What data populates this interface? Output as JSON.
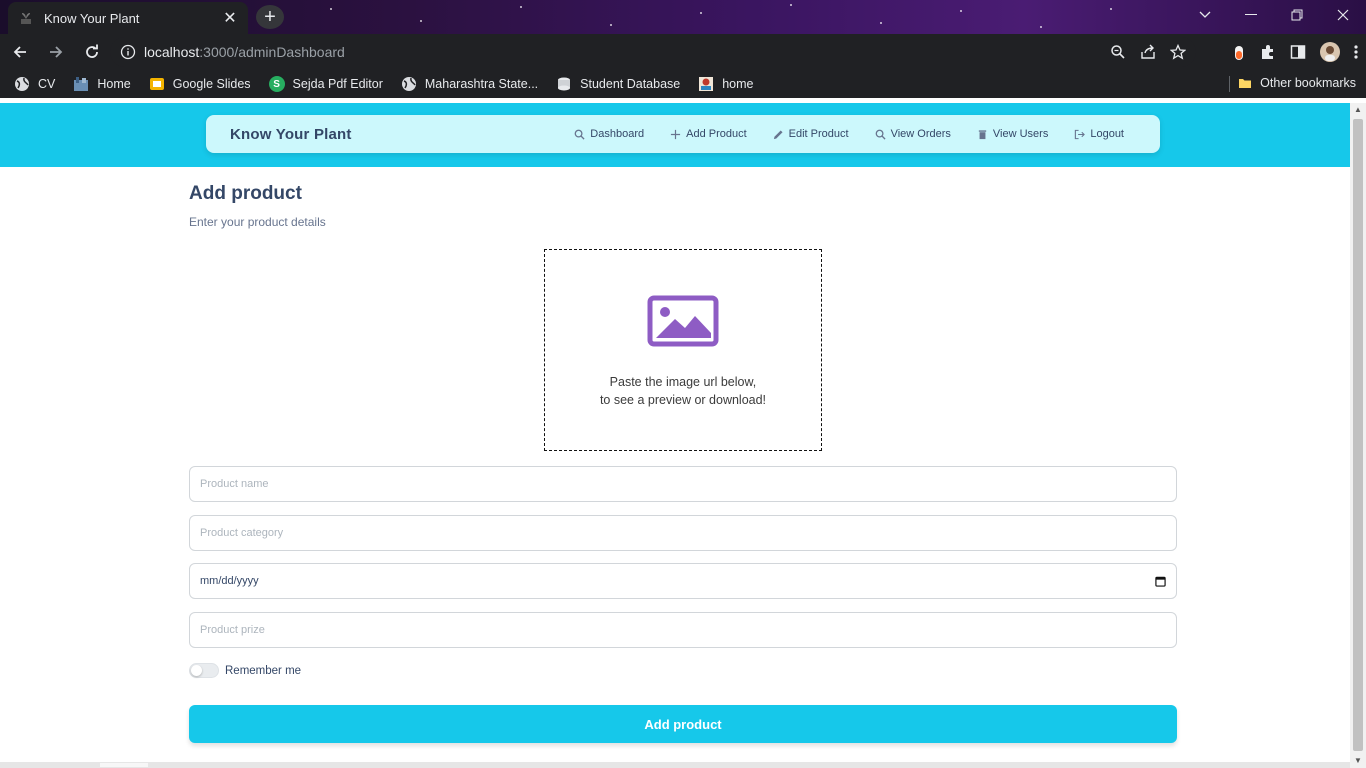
{
  "browser": {
    "tab_title": "Know Your Plant",
    "url_host": "localhost",
    "url_path": ":3000/adminDashboard",
    "bookmarks": [
      {
        "label": "CV",
        "icon": "globe-icon"
      },
      {
        "label": "Home",
        "icon": "home-favicon"
      },
      {
        "label": "Google Slides",
        "icon": "slides-icon",
        "color": "#f4b400"
      },
      {
        "label": "Sejda Pdf Editor",
        "icon": "sejda-icon",
        "color": "#27ae60"
      },
      {
        "label": "Maharashtra State...",
        "icon": "globe-icon"
      },
      {
        "label": "Student Database",
        "icon": "database-icon"
      },
      {
        "label": "home",
        "icon": "home-favicon"
      }
    ],
    "other_bookmarks": "Other bookmarks"
  },
  "navbar": {
    "brand": "Know Your Plant",
    "links": [
      {
        "label": "Dashboard",
        "icon": "search-icon"
      },
      {
        "label": "Add Product",
        "icon": "plus-icon"
      },
      {
        "label": "Edit Product",
        "icon": "pencil-icon"
      },
      {
        "label": "View Orders",
        "icon": "search-icon"
      },
      {
        "label": "View Users",
        "icon": "trash-icon"
      },
      {
        "label": "Logout",
        "icon": "logout-icon"
      }
    ]
  },
  "form": {
    "title": "Add product",
    "subtitle": "Enter your product details",
    "preview_hint_line1": "Paste the image url below,",
    "preview_hint_line2": "to see a preview or download!",
    "name_placeholder": "Product name",
    "category_placeholder": "Product category",
    "date_placeholder": "mm/dd/yyyy",
    "price_placeholder": "Product prize",
    "remember_label": "Remember me",
    "submit_label": "Add product"
  },
  "colors": {
    "accent": "#16c8ea",
    "navbar_bg": "#ccf8fc",
    "image_icon": "#8e5cc4",
    "heading": "#344767"
  }
}
